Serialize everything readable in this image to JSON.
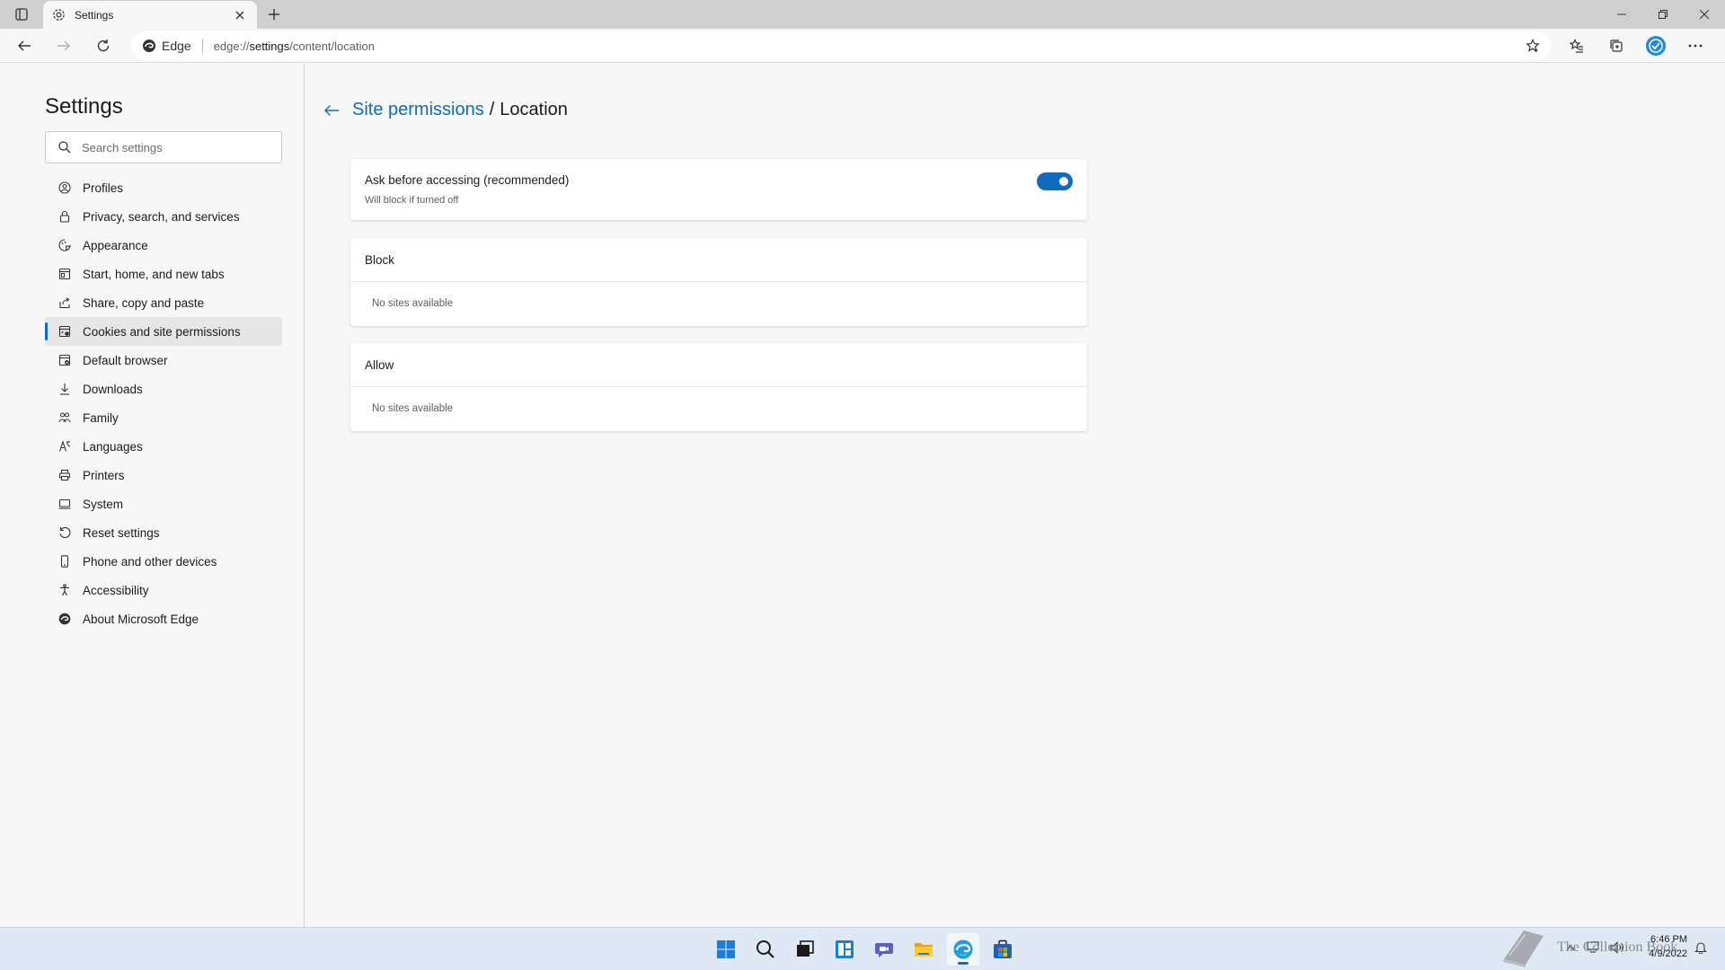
{
  "window": {
    "tab_title": "Settings"
  },
  "addressbar": {
    "site_label": "Edge",
    "url_prefix": "edge://",
    "url_host": "settings",
    "url_path": "/content/location"
  },
  "sidebar": {
    "title": "Settings",
    "search_placeholder": "Search settings",
    "items": [
      {
        "label": "Profiles",
        "icon": "profile-icon"
      },
      {
        "label": "Privacy, search, and services",
        "icon": "lock-icon"
      },
      {
        "label": "Appearance",
        "icon": "appearance-icon"
      },
      {
        "label": "Start, home, and new tabs",
        "icon": "home-icon"
      },
      {
        "label": "Share, copy and paste",
        "icon": "share-icon"
      },
      {
        "label": "Cookies and site permissions",
        "icon": "cookies-icon",
        "active": true
      },
      {
        "label": "Default browser",
        "icon": "browser-icon"
      },
      {
        "label": "Downloads",
        "icon": "download-icon"
      },
      {
        "label": "Family",
        "icon": "family-icon"
      },
      {
        "label": "Languages",
        "icon": "languages-icon"
      },
      {
        "label": "Printers",
        "icon": "printer-icon"
      },
      {
        "label": "System",
        "icon": "system-icon"
      },
      {
        "label": "Reset settings",
        "icon": "reset-icon"
      },
      {
        "label": "Phone and other devices",
        "icon": "phone-icon"
      },
      {
        "label": "Accessibility",
        "icon": "accessibility-icon"
      },
      {
        "label": "About Microsoft Edge",
        "icon": "edge-icon"
      }
    ]
  },
  "main": {
    "breadcrumb_parent": "Site permissions",
    "breadcrumb_sep": "/",
    "breadcrumb_current": "Location",
    "ask_card": {
      "title": "Ask before accessing (recommended)",
      "subtitle": "Will block if turned off",
      "toggle_on": true
    },
    "block_card": {
      "title": "Block",
      "empty_text": "No sites available"
    },
    "allow_card": {
      "title": "Allow",
      "empty_text": "No sites available"
    }
  },
  "taskbar": {
    "watermark_text": "The Collection Book",
    "time": "6:46 PM",
    "date": "4/9/2022"
  },
  "colors": {
    "accent": "#0f6cbd",
    "background": "#f7f7f7",
    "card": "#ffffff"
  }
}
